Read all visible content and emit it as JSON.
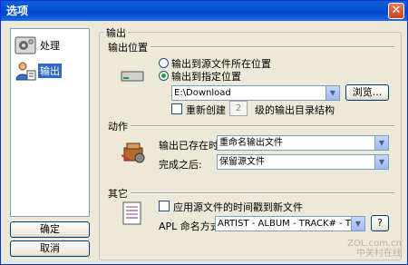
{
  "window": {
    "title": "选项",
    "close_glyph": "✕"
  },
  "nav": {
    "items": [
      {
        "label": "处理",
        "icon": "gear-icon"
      },
      {
        "label": "输出",
        "icon": "output-user-icon"
      }
    ]
  },
  "buttons": {
    "ok": "确定",
    "cancel": "取消"
  },
  "main": {
    "group_title": "输出",
    "output_location": {
      "section_label": "输出位置",
      "radio_source": "输出到源文件所在位置",
      "radio_specified": "输出到指定位置",
      "selected": "specified",
      "path_value": "E:\\Download",
      "browse_label": "浏览...",
      "recreate_label": "重新创建",
      "recreate_checked": false,
      "levels_value": "2",
      "levels_suffix": "级的输出目录结构"
    },
    "action": {
      "section_label": "动作",
      "exists_label": "输出已存在时:",
      "exists_value": "重命名输出文件",
      "after_label": "完成之后:",
      "after_value": "保留源文件"
    },
    "other": {
      "section_label": "其它",
      "apply_time_label": "应用源文件的时间戳到新文件",
      "apply_time_checked": false,
      "apl_label": "APL 命名方式:",
      "apl_value": "ARTIST - ALBUM - TRACK# - TITLE",
      "help_label": "?"
    }
  },
  "watermark": {
    "site": "ZOL.com.cn",
    "sub": "中关村在线"
  }
}
